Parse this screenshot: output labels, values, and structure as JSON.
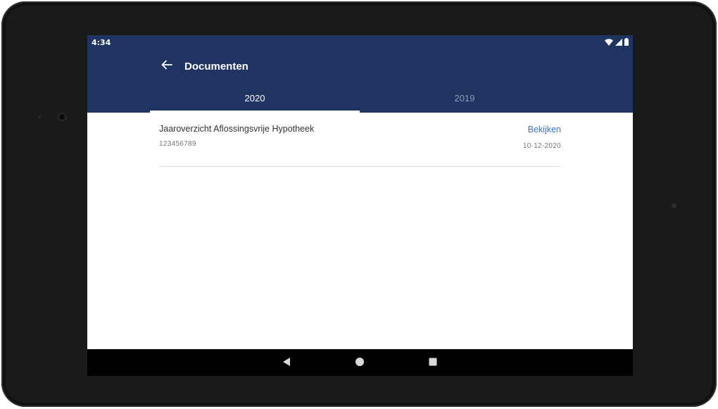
{
  "status_bar": {
    "time": "4:34",
    "icons": [
      "wifi-icon",
      "cell-signal-icon",
      "battery-icon"
    ]
  },
  "toolbar": {
    "back_icon": "arrow-left-icon",
    "title": "Documenten"
  },
  "tabs": [
    {
      "label": "2020",
      "active": true
    },
    {
      "label": "2019",
      "active": false
    }
  ],
  "documents": [
    {
      "title": "Jaaroverzicht Aflossingsvrije Hypotheek",
      "number": "123456789",
      "action_label": "Bekijken",
      "date": "10-12-2020"
    }
  ],
  "nav_bar": {
    "buttons": [
      "back-triangle-icon",
      "home-circle-icon",
      "recents-square-icon"
    ]
  },
  "colors": {
    "app_bar": "#1f3461",
    "link": "#3a73bd",
    "tab_inactive": "#8d9ab4"
  }
}
